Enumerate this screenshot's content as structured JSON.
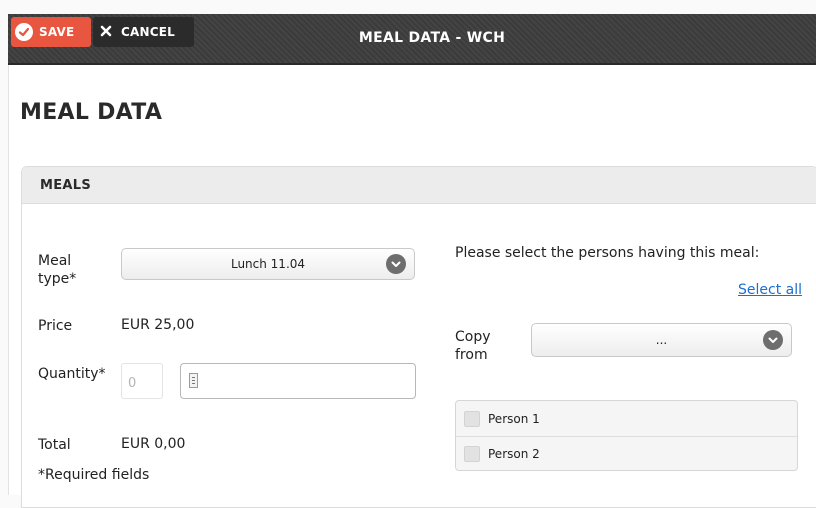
{
  "toolbar": {
    "save_label": "SAVE",
    "cancel_label": "CANCEL",
    "window_title": "MEAL DATA - WCH"
  },
  "page": {
    "title": "MEAL DATA"
  },
  "panel": {
    "title": "MEALS"
  },
  "form": {
    "meal_type_label": "Meal type*",
    "meal_type_value": "Lunch 11.04",
    "price_label": "Price",
    "price_value": "EUR 25,00",
    "quantity_label": "Quantity*",
    "quantity_value": "0",
    "total_label": "Total",
    "total_value": "EUR 0,00",
    "required_note": "*Required fields"
  },
  "persons_section": {
    "prompt": "Please select the persons having this meal:",
    "select_all": "Select all",
    "copy_from_label": "Copy from",
    "copy_from_value": "...",
    "persons": [
      {
        "name": "Person 1",
        "checked": false
      },
      {
        "name": "Person 2",
        "checked": false
      }
    ]
  },
  "colors": {
    "save_button": "#e8563f",
    "cancel_button": "#2b2b2b",
    "topbar": "#3d3d3d",
    "link": "#1a6fd1"
  }
}
